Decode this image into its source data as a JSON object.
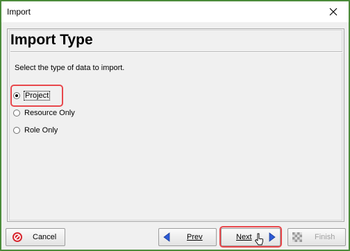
{
  "window": {
    "title": "Import"
  },
  "page": {
    "heading": "Import Type",
    "instruction": "Select the type of data to import."
  },
  "options": [
    {
      "label": "Project",
      "selected": true
    },
    {
      "label": "Resource Only",
      "selected": false
    },
    {
      "label": "Role Only",
      "selected": false
    }
  ],
  "buttons": {
    "cancel": "Cancel",
    "prev": "Prev",
    "next": "Next",
    "finish": "Finish"
  },
  "colors": {
    "frame": "#4b8b3a",
    "highlight": "#e8474b",
    "arrow": "#2d5bd6",
    "cancel_icon": "#d7262e"
  }
}
